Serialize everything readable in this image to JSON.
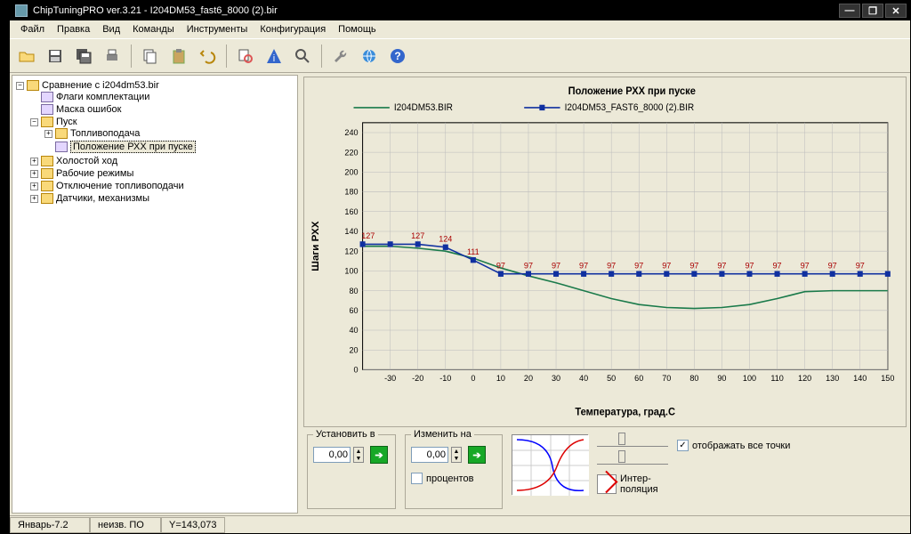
{
  "window": {
    "title": "ChipTuningPRO ver.3.21 - I204DM53_fast6_8000 (2).bir"
  },
  "menu": [
    "Файл",
    "Правка",
    "Вид",
    "Команды",
    "Инструменты",
    "Конфигурация",
    "Помощь"
  ],
  "tree": {
    "root": "Сравнение с i204dm53.bir",
    "n1": "Флаги комплектации",
    "n2": "Маска ошибок",
    "n3": "Пуск",
    "n3a": "Топливоподача",
    "n3b": "Положение РХХ при пуске",
    "n4": "Холостой ход",
    "n5": "Рабочие режимы",
    "n6": "Отключение топливоподачи",
    "n7": "Датчики, механизмы"
  },
  "chart_data": {
    "type": "line",
    "title": "Положение РХХ при пуске",
    "xlabel": "Температура, град.С",
    "ylabel": "Шаги РХХ",
    "xlim": [
      -40,
      150
    ],
    "ylim": [
      0,
      250
    ],
    "xticks": [
      -30,
      -20,
      -10,
      0,
      10,
      20,
      30,
      40,
      50,
      60,
      70,
      80,
      90,
      100,
      110,
      120,
      130,
      140,
      150
    ],
    "yticks": [
      0,
      20,
      40,
      60,
      80,
      100,
      120,
      140,
      160,
      180,
      200,
      220,
      240
    ],
    "series": [
      {
        "name": "I204DM53.BIR",
        "color": "#1a7a4a",
        "x": [
          -40,
          -30,
          -20,
          -10,
          0,
          10,
          20,
          30,
          40,
          50,
          60,
          70,
          80,
          90,
          100,
          110,
          120,
          130,
          140,
          150
        ],
        "y": [
          125,
          125,
          123,
          120,
          113,
          103,
          95,
          88,
          80,
          72,
          66,
          63,
          62,
          63,
          66,
          72,
          79,
          80,
          80,
          80
        ]
      },
      {
        "name": "I204DM53_FAST6_8000 (2).BIR",
        "color": "#1030a0",
        "x": [
          -40,
          -30,
          -20,
          -10,
          0,
          10,
          20,
          30,
          40,
          50,
          60,
          70,
          80,
          90,
          100,
          110,
          120,
          130,
          140,
          150
        ],
        "y": [
          127,
          127,
          127,
          124,
          111,
          97,
          97,
          97,
          97,
          97,
          97,
          97,
          97,
          97,
          97,
          97,
          97,
          97,
          97,
          97
        ]
      }
    ],
    "labels": [
      {
        "x": -38,
        "y": 127,
        "text": "127"
      },
      {
        "x": -20,
        "y": 127,
        "text": "127"
      },
      {
        "x": -10,
        "y": 124,
        "text": "124"
      },
      {
        "x": 0,
        "y": 111,
        "text": "111"
      },
      {
        "x": 10,
        "y": 97,
        "text": "97"
      },
      {
        "x": 20,
        "y": 97,
        "text": "97"
      },
      {
        "x": 30,
        "y": 97,
        "text": "97"
      },
      {
        "x": 40,
        "y": 97,
        "text": "97"
      },
      {
        "x": 50,
        "y": 97,
        "text": "97"
      },
      {
        "x": 60,
        "y": 97,
        "text": "97"
      },
      {
        "x": 70,
        "y": 97,
        "text": "97"
      },
      {
        "x": 80,
        "y": 97,
        "text": "97"
      },
      {
        "x": 90,
        "y": 97,
        "text": "97"
      },
      {
        "x": 100,
        "y": 97,
        "text": "97"
      },
      {
        "x": 110,
        "y": 97,
        "text": "97"
      },
      {
        "x": 120,
        "y": 97,
        "text": "97"
      },
      {
        "x": 130,
        "y": 97,
        "text": "97"
      },
      {
        "x": 140,
        "y": 97,
        "text": "97"
      }
    ]
  },
  "controls": {
    "set_label": "Установить в",
    "set_value": "0,00",
    "change_label": "Изменить на",
    "change_value": "0,00",
    "percent_label": "процентов",
    "interp_label": "Интер-\nполяция",
    "showall_label": "отображать все точки"
  },
  "status": {
    "c1": "Январь-7.2",
    "c2": "неизв. ПО",
    "c3": "Y=143,073"
  }
}
